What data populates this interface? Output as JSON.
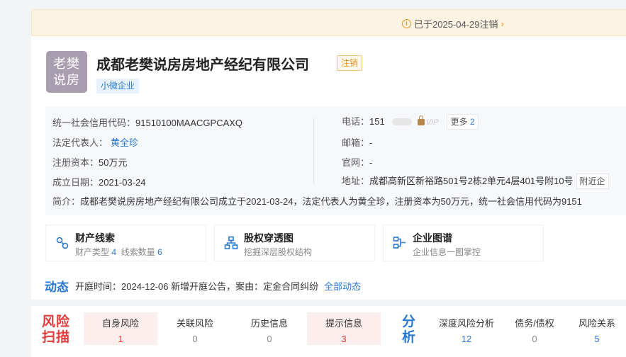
{
  "banner": {
    "text": "已于2025-04-29注销"
  },
  "company": {
    "logo_line1": "老樊",
    "logo_line2": "说房",
    "name": "成都老樊说房房地产经纪有限公司",
    "status_tag": "注销",
    "size_tag": "小微企业"
  },
  "info": {
    "credit_label": "统一社会信用代码：",
    "credit_value": "91510100MAACGPCAXQ",
    "legal_label": "法定代表人：",
    "legal_value": "黄全珍",
    "capital_label": "注册资本：",
    "capital_value": "50万元",
    "date_label": "成立日期：",
    "date_value": "2021-03-24",
    "phone_label": "电话：",
    "phone_value": "151",
    "vip_text": "VIP",
    "more_label": "更多",
    "more_count": "2",
    "email_label": "邮箱：",
    "email_value": "-",
    "website_label": "官网：",
    "website_value": "-",
    "address_label": "地址：",
    "address_value": "成都高新区新裕路501号2栋2单元4层401号附10号",
    "nearby_label": "附近企",
    "intro_label": "简介：",
    "intro_value": "成都老樊说房房地产经纪有限公司成立于2021-03-24，法定代表人为黄全珍，注册资本为50万元，统一社会信用代码为9151"
  },
  "features": [
    {
      "title": "财产线索",
      "sub_a": "财产类型",
      "num_a": "4",
      "sub_b": "线索数量",
      "num_b": "6"
    },
    {
      "title": "股权穿透图",
      "sub": "挖掘深层股权结构"
    },
    {
      "title": "企业图谱",
      "sub": "企业信息一图掌控"
    }
  ],
  "dynamics": {
    "label": "动态",
    "text": "开庭时间：2024-12-06 新增开庭公告，案由：定金合同纠纷",
    "link": "全部动态"
  },
  "risk": {
    "title": "风险扫描",
    "items": [
      {
        "label": "自身风险",
        "value": "1"
      },
      {
        "label": "关联风险",
        "value": "0"
      },
      {
        "label": "历史信息",
        "value": "0"
      },
      {
        "label": "提示信息",
        "value": "3"
      }
    ]
  },
  "analysis": {
    "title": "分析",
    "items": [
      {
        "label": "深度风险分析",
        "value": "12"
      },
      {
        "label": "债务/债权",
        "value": "0"
      },
      {
        "label": "风险关系",
        "value": "5"
      }
    ]
  },
  "colors": {
    "accent": "#2979d0",
    "warning": "#e8921e",
    "danger": "#e23b3b"
  }
}
